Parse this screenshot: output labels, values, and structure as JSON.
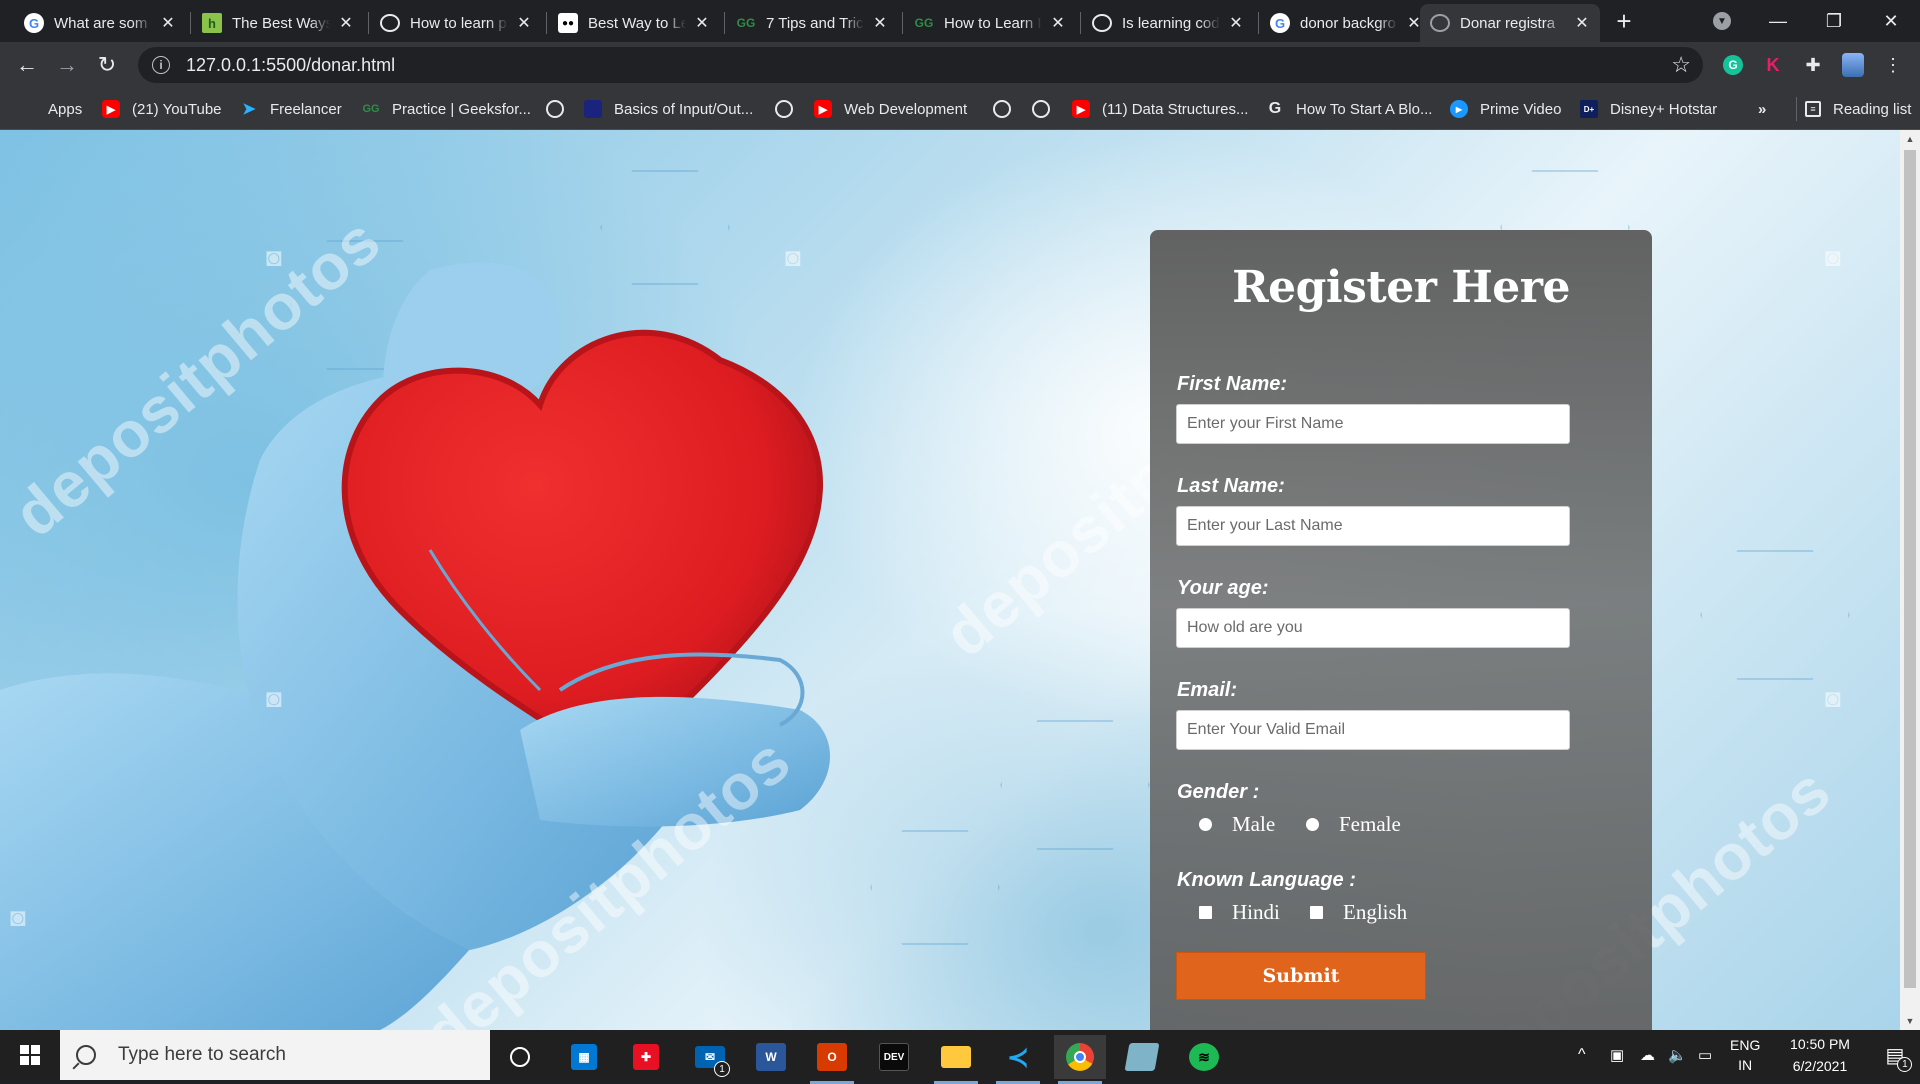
{
  "browser": {
    "tabs": [
      {
        "title": "What are som",
        "icon": "google-icon"
      },
      {
        "title": "The Best Ways",
        "icon": "hashnode-icon"
      },
      {
        "title": "How to learn p",
        "icon": "globe-icon"
      },
      {
        "title": "Best Way to Le",
        "icon": "medium-icon"
      },
      {
        "title": "7 Tips and Tric",
        "icon": "geeksforgeeks-icon"
      },
      {
        "title": "How to Learn I",
        "icon": "geeksforgeeks-icon"
      },
      {
        "title": "Is learning cod",
        "icon": "globe-icon"
      },
      {
        "title": "donor backgro",
        "icon": "google-icon"
      },
      {
        "title": "Donar registra",
        "icon": "globe-icon",
        "active": true
      }
    ],
    "close_glyph": "✕",
    "new_tab_glyph": "+",
    "url": "127.0.0.1:5500/donar.html",
    "info_glyph": "i",
    "bookmarks": [
      {
        "label": "Apps",
        "icon": "apps-grid-icon"
      },
      {
        "label": "(21) YouTube",
        "icon": "youtube-icon"
      },
      {
        "label": "Freelancer",
        "icon": "freelancer-icon"
      },
      {
        "label": "Practice | Geeksfor...",
        "icon": "geeksforgeeks-icon"
      },
      {
        "label": "",
        "icon": "globe-icon"
      },
      {
        "label": "Basics of Input/Out...",
        "icon": "site-icon"
      },
      {
        "label": "",
        "icon": "globe-icon"
      },
      {
        "label": "Web Development",
        "icon": "youtube-icon"
      },
      {
        "label": "",
        "icon": "globe-icon"
      },
      {
        "label": "",
        "icon": "globe-icon"
      },
      {
        "label": "(11) Data Structures...",
        "icon": "youtube-icon"
      },
      {
        "label": "How To Start A Blo...",
        "icon": "google-icon"
      },
      {
        "label": "Prime Video",
        "icon": "prime-video-icon"
      },
      {
        "label": "Disney+ Hotstar",
        "icon": "hotstar-icon"
      }
    ],
    "more_bookmarks": "»",
    "reading_list": "Reading list"
  },
  "form": {
    "title": "Register Here",
    "first_name_label": "First Name:",
    "first_name_placeholder": "Enter your First Name",
    "last_name_label": "Last Name:",
    "last_name_placeholder": "Enter your Last Name",
    "age_label": "Your age:",
    "age_placeholder": "How old are you",
    "email_label": "Email:",
    "email_placeholder": "Enter Your Valid Email",
    "gender_label": "Gender :",
    "gender_options": [
      "Male",
      "Female"
    ],
    "language_label": "Known Language :",
    "language_options": [
      "Hindi",
      "English"
    ],
    "submit_label": "Submit"
  },
  "background": {
    "watermark": "depositphotos",
    "heart_color": "#e01e22",
    "glove_color": "#8cc8ec"
  },
  "taskbar": {
    "search_placeholder": "Type here to search",
    "apps": [
      "cortana-icon",
      "microsoft-store-icon",
      "gift-icon",
      "mail-icon",
      "word-icon",
      "office-icon",
      "dev-icon",
      "file-explorer-icon",
      "vscode-icon",
      "chrome-icon",
      "notepad-icon",
      "spotify-icon"
    ],
    "mail_badge": "1",
    "language": "ENG",
    "region": "IN",
    "time": "10:50 PM",
    "date": "6/2/2021",
    "notification_badge": "1"
  },
  "colors": {
    "submit": "#e0641c",
    "card": "#606060",
    "chrome_dark": "#202124"
  }
}
